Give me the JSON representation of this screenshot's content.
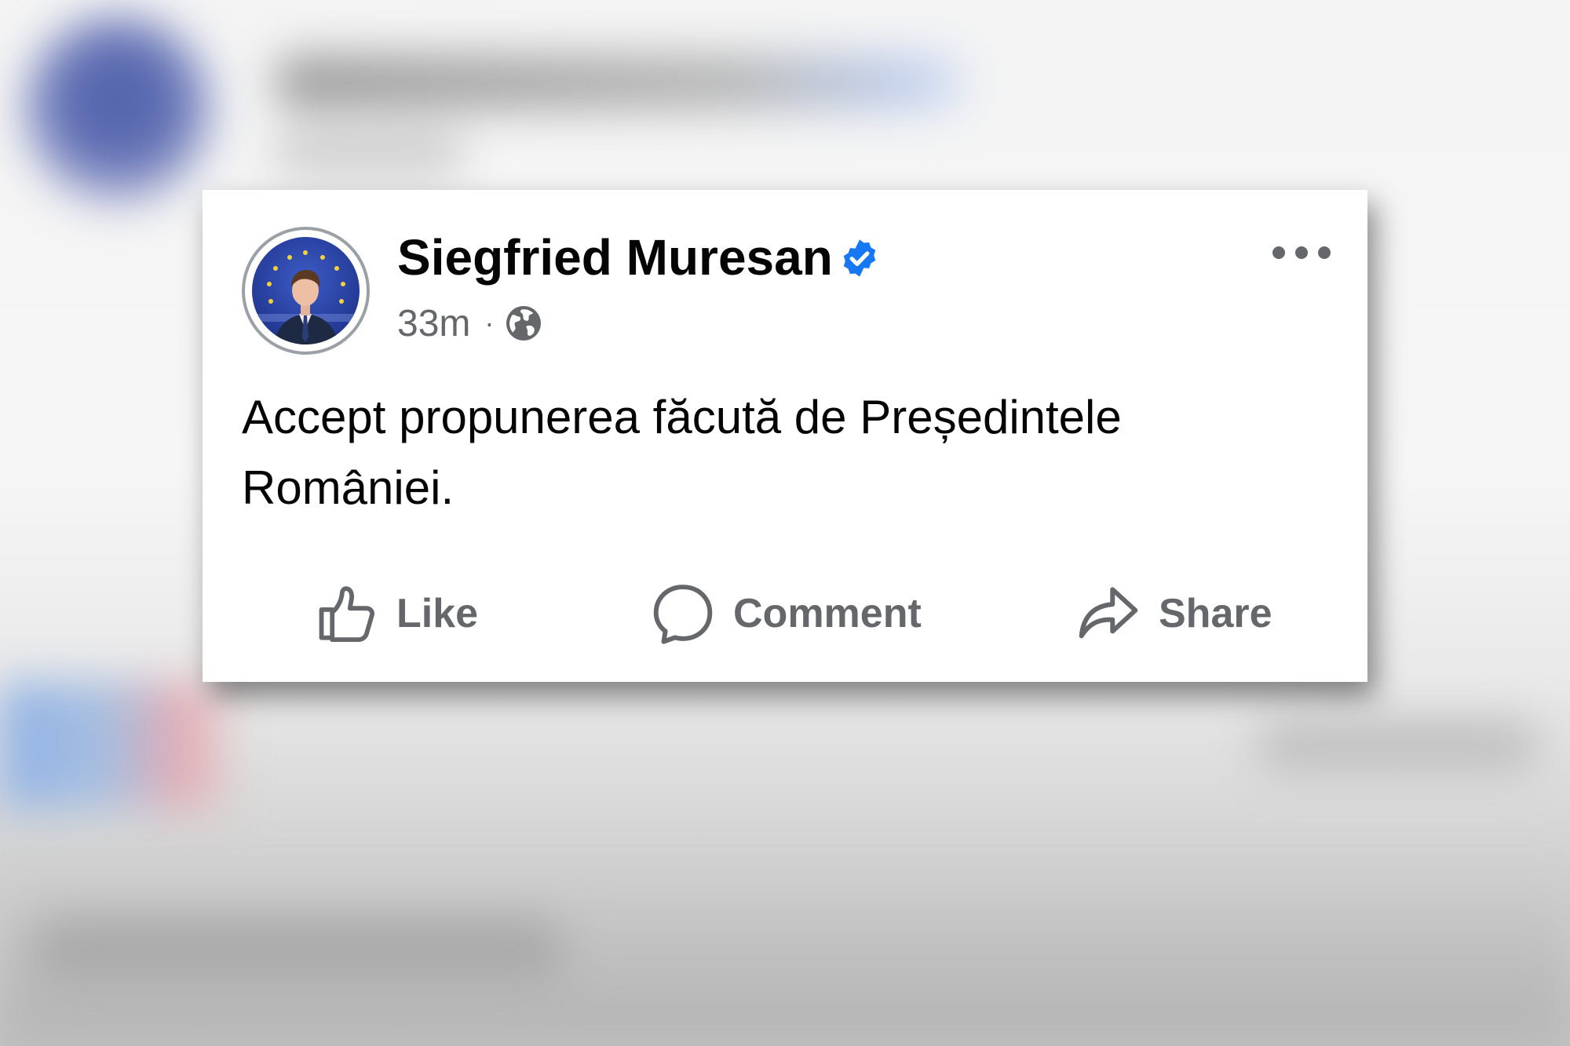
{
  "post": {
    "author_name": "Siegfried Muresan",
    "verified": true,
    "time_ago": "33m",
    "separator": "·",
    "audience_icon": "globe-icon",
    "text_lines": [
      "Accept propunerea făcută de Președintele",
      "României."
    ],
    "more_icon": "more-horizontal-icon"
  },
  "actions": {
    "like_label": "Like",
    "comment_label": "Comment",
    "share_label": "Share"
  },
  "colors": {
    "verified_blue": "#1877f2",
    "secondary_text": "#65676b",
    "primary_text": "#050505",
    "eu_blue": "#2a46a8"
  }
}
